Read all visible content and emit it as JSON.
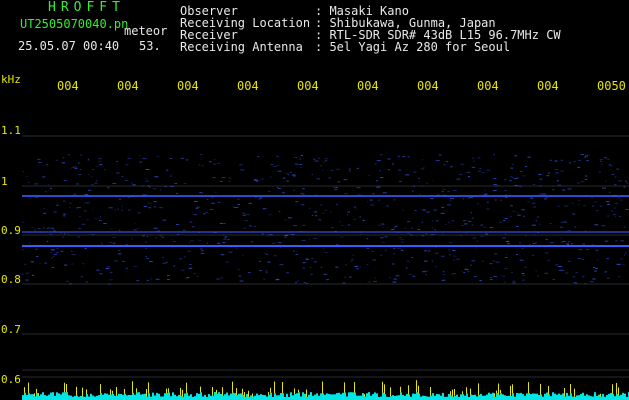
{
  "header": {
    "brand": "HROFFT",
    "filename": "UT2505070040.pn",
    "meteor_label": "meteor",
    "datetime": "25.05.07 00:40",
    "count": "53.",
    "info": [
      {
        "label": "Observer",
        "value": ": Masaki Kano"
      },
      {
        "label": "Receiving Location",
        "value": ": Shibukawa, Gunma, Japan"
      },
      {
        "label": "Receiver",
        "value": ": RTL-SDR SDR# 43dB L15 96.7MHz CW"
      },
      {
        "label": "Receiving Antenna",
        "value": ": 5el Yagi Az 280 for Seoul"
      }
    ]
  },
  "axis": {
    "unit": "kHz",
    "time_ticks": [
      "004",
      "004",
      "004",
      "004",
      "004",
      "004",
      "004",
      "004",
      "004",
      "0050"
    ],
    "freq_ticks": [
      "1.1",
      "1",
      "0.9",
      "0.8",
      "0.7",
      "0.6"
    ]
  },
  "colors": {
    "background": "#000000",
    "header_green": "#33ee33",
    "header_white": "#e8e8e8",
    "tick_yellow": "#e6e600",
    "signal_blue": "#3a5cff",
    "baseline_cyan": "#00e5e5"
  }
}
